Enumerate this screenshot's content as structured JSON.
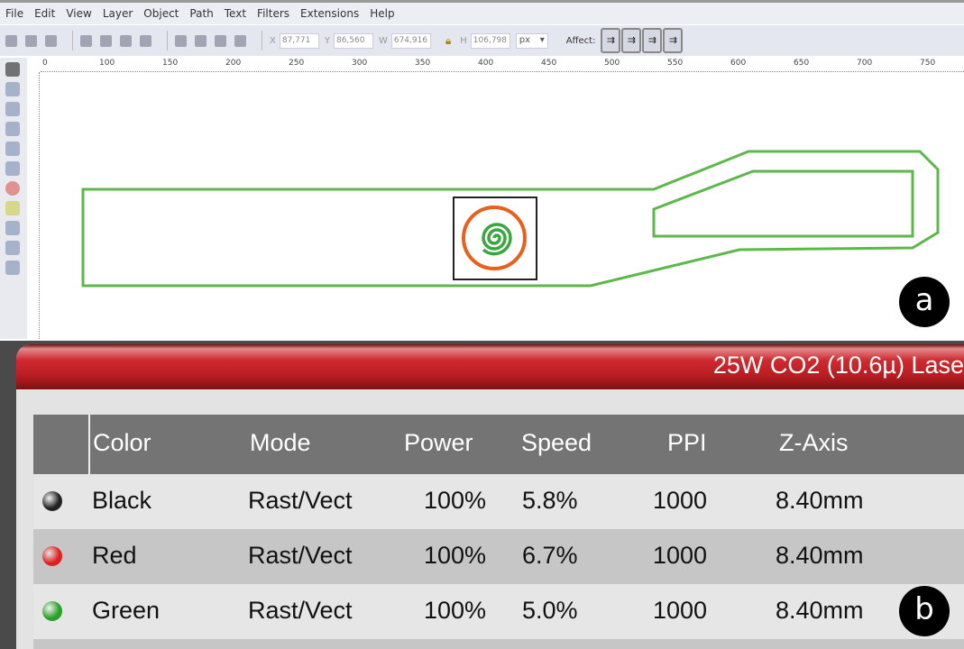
{
  "menu": [
    "File",
    "Edit",
    "View",
    "Layer",
    "Object",
    "Path",
    "Text",
    "Filters",
    "Extensions",
    "Help"
  ],
  "toolbar": {
    "x_label": "X",
    "x": "87,771",
    "y_label": "Y",
    "y": "86,560",
    "w_label": "W",
    "w": "674,916",
    "h_label": "H",
    "h": "106,798",
    "unit": "px",
    "affect": "Affect:"
  },
  "ruler": [
    "0",
    "100",
    "150",
    "200",
    "250",
    "300",
    "350",
    "400",
    "450",
    "500",
    "550",
    "600",
    "650",
    "700",
    "750"
  ],
  "badges": {
    "a": "a",
    "b": "b"
  },
  "colors": {
    "outline": "#5cb84a",
    "spiral_outer": "#e8601c",
    "spiral_inner": "#3aa640"
  },
  "laser": {
    "title": "25W CO2 (10.6µ) Lase",
    "headers": [
      "Color",
      "Mode",
      "Power",
      "Speed",
      "PPI",
      "Z-Axis"
    ],
    "rows": [
      {
        "dot": "#222222",
        "color": "Black",
        "mode": "Rast/Vect",
        "power": "100%",
        "speed": "5.8%",
        "ppi": "1000",
        "z": "8.40mm"
      },
      {
        "dot": "#e02020",
        "color": "Red",
        "mode": "Rast/Vect",
        "power": "100%",
        "speed": "6.7%",
        "ppi": "1000",
        "z": "8.40mm"
      },
      {
        "dot": "#2aa02a",
        "color": "Green",
        "mode": "Rast/Vect",
        "power": "100%",
        "speed": "5.0%",
        "ppi": "1000",
        "z": "8.40mm"
      }
    ]
  }
}
